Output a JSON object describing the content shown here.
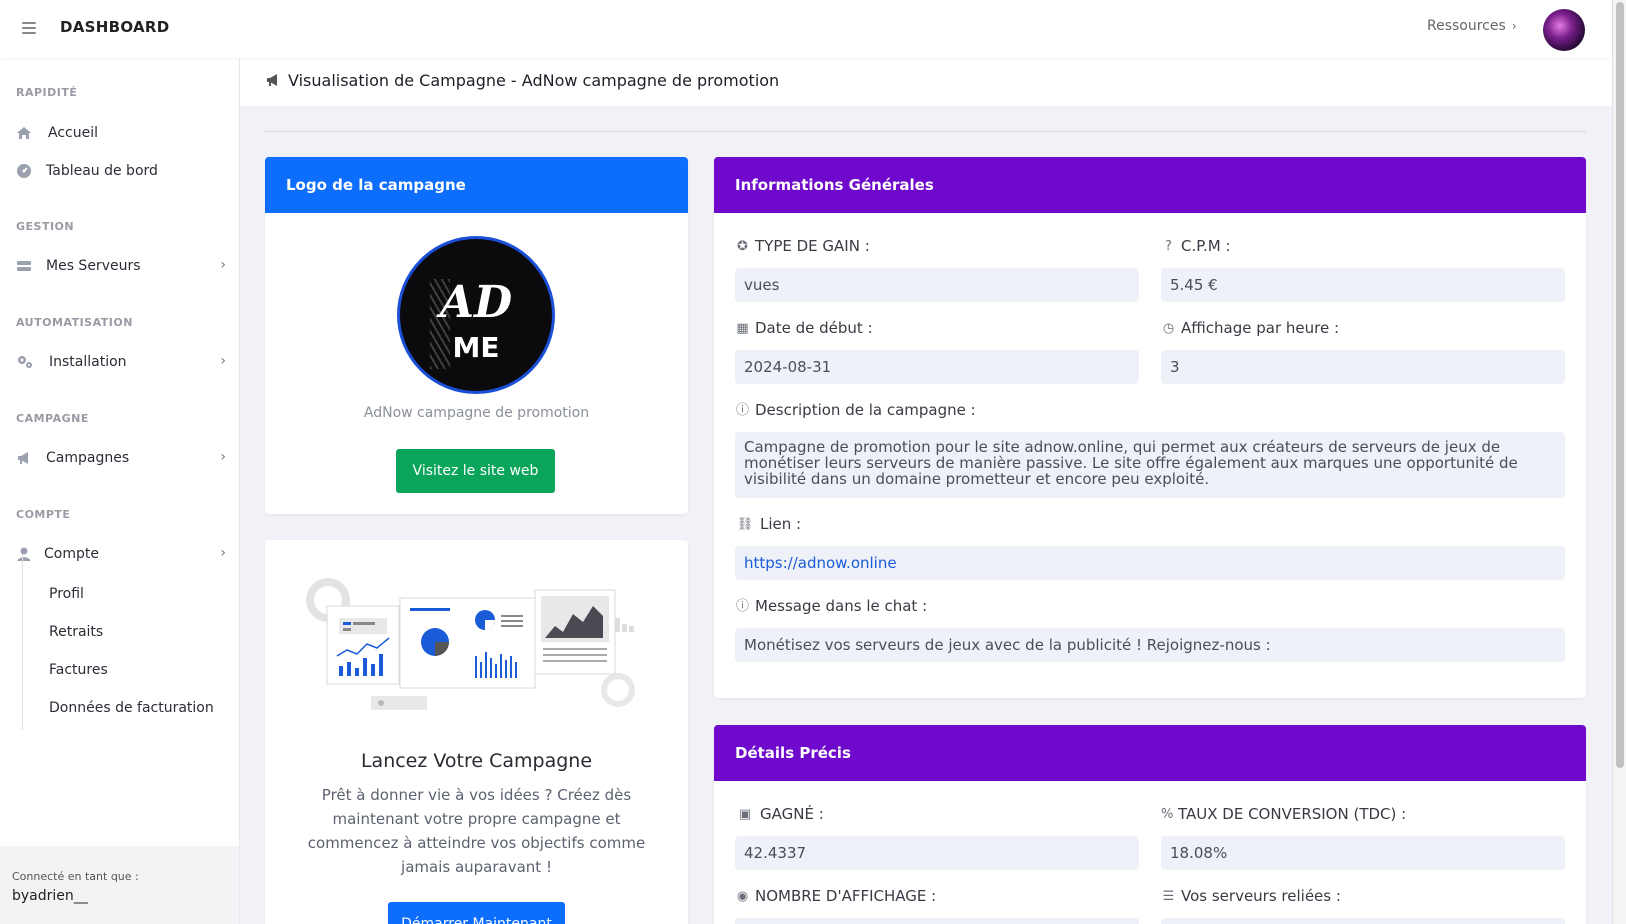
{
  "topbar": {
    "brand": "DASHBOARD",
    "resources_label": "Ressources",
    "chevron": "›"
  },
  "sidebar": {
    "sections": {
      "rapidite": "RAPIDITÉ",
      "gestion": "GESTION",
      "automatisation": "AUTOMATISATION",
      "campagne": "CAMPAGNE",
      "compte": "COMPTE"
    },
    "items": {
      "accueil": {
        "label": "Accueil",
        "icon": "home-icon"
      },
      "tableau": {
        "label": "Tableau de bord",
        "icon": "gauge-icon"
      },
      "serveurs": {
        "label": "Mes Serveurs",
        "icon": "server-icon"
      },
      "installation": {
        "label": "Installation",
        "icon": "cogs-icon"
      },
      "campagnes": {
        "label": "Campagnes",
        "icon": "megaphone-icon"
      },
      "compte": {
        "label": "Compte",
        "icon": "user-icon"
      }
    },
    "sub_items": {
      "profil": "Profil",
      "retraits": "Retraits",
      "factures": "Factures",
      "donnees": "Données de facturation"
    },
    "footer": {
      "connected_label": "Connecté en tant que :",
      "username": "byadrien__"
    }
  },
  "page": {
    "title": "Visualisation de Campagne - AdNow campagne de promotion"
  },
  "logo_card": {
    "header": "Logo de la campagne",
    "logo_line1": "AD",
    "logo_line2": "ME",
    "caption": "AdNow campagne de promotion",
    "button": "Visitez le site web"
  },
  "launch_card": {
    "title": "Lancez Votre Campagne",
    "text": "Prêt à donner vie à vos idées ? Créez dès maintenant votre propre campagne et commencez à atteindre vos objectifs comme jamais auparavant !",
    "button": "Démarrer Maintenant"
  },
  "info_card": {
    "header": "Informations Générales",
    "type_gain_label": "TYPE DE GAIN :",
    "type_gain_value": "vues",
    "cpm_label": "C.P.M :",
    "cpm_value": "5.45 €",
    "date_label": "Date de début :",
    "date_value": "2024-08-31",
    "affichage_label": "Affichage par heure :",
    "affichage_value": "3",
    "description_label": "Description de la campagne :",
    "description_value": "Campagne de promotion pour le site adnow.online, qui permet aux créateurs de serveurs de jeux de monétiser leurs serveurs de manière passive. Le site offre également aux marques une opportunité de visibilité dans un domaine prometteur et encore peu exploité.",
    "lien_label": "Lien :",
    "lien_value": "https://adnow.online",
    "message_label": "Message dans le chat :",
    "message_value": "Monétisez vos serveurs de jeux avec de la publicité ! Rejoignez-nous :"
  },
  "details_card": {
    "header": "Détails Précis",
    "gagne_label": "GAGNÉ :",
    "gagne_value": "42.4337",
    "tdc_label": "TAUX DE CONVERSION (TDC) :",
    "tdc_value": "18.08%",
    "nombre_label": "NOMBRE D'AFFICHAGE :",
    "serveurs_label": "Vos serveurs reliées :"
  }
}
